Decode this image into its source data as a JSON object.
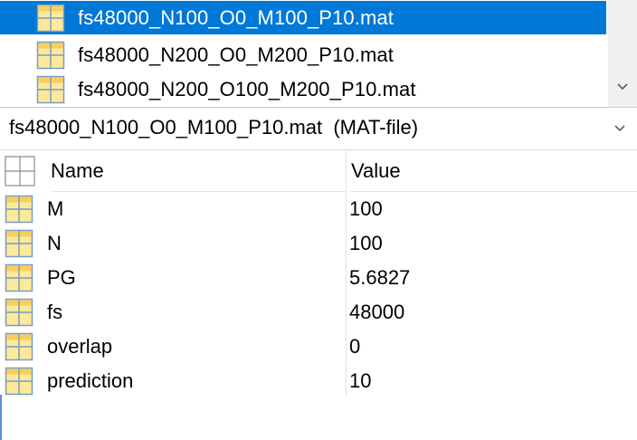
{
  "file_list": {
    "items": [
      {
        "name": "fs48000_N100_O0_M100_P10.mat",
        "selected": true
      },
      {
        "name": "fs48000_N200_O0_M200_P10.mat",
        "selected": false
      },
      {
        "name": "fs48000_N200_O100_M200_P10.mat",
        "selected": false
      }
    ],
    "scroll_down_icon": "chevron-down-icon"
  },
  "details": {
    "title": "fs48000_N100_O0_M100_P10.mat  (MAT-file)",
    "collapse_icon": "chevron-down-icon"
  },
  "variables": {
    "columns": {
      "name": "Name",
      "value": "Value"
    },
    "rows": [
      {
        "name": "M",
        "value": "100"
      },
      {
        "name": "N",
        "value": "100"
      },
      {
        "name": "PG",
        "value": "5.6827"
      },
      {
        "name": "fs",
        "value": "48000"
      },
      {
        "name": "overlap",
        "value": "0"
      },
      {
        "name": "prediction",
        "value": "10"
      }
    ]
  },
  "colors": {
    "selection": "#0078d7",
    "icon_fill": "#fde99a",
    "icon_border": "#7a9cc6"
  }
}
